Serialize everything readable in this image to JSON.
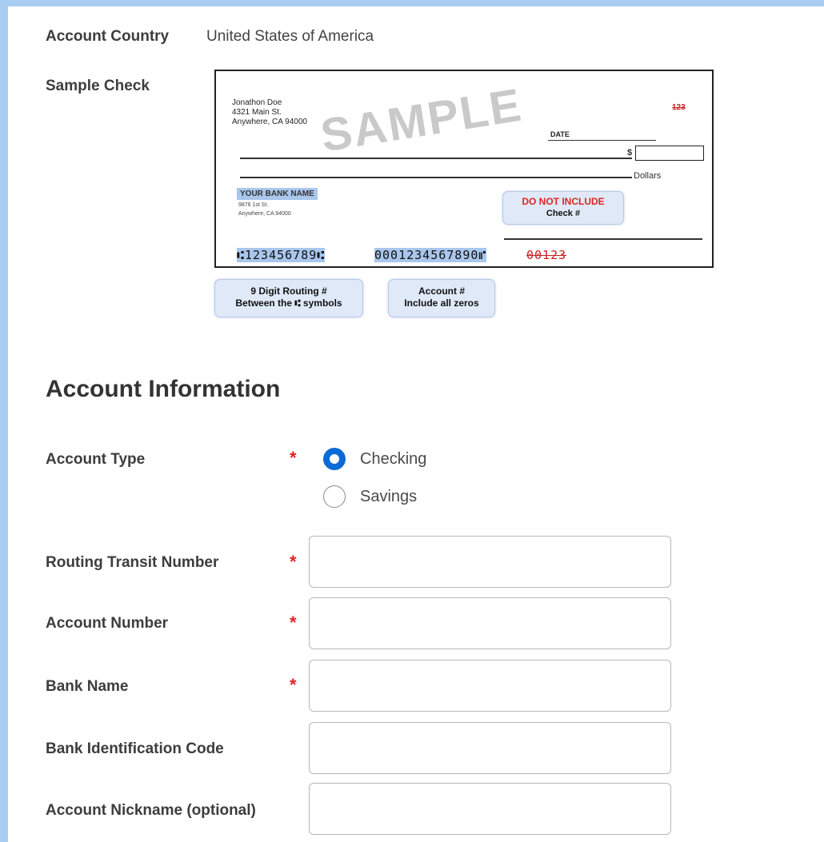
{
  "account_country": {
    "label": "Account Country",
    "value": "United States of America"
  },
  "sample_check": {
    "label": "Sample Check",
    "check": {
      "owner_name": "Jonathon Doe",
      "owner_street": "4321 Main St.",
      "owner_city": "Anywhere, CA 94000",
      "watermark": "SAMPLE",
      "check_number": "123",
      "date_label": "DATE",
      "dollar_sign": "$",
      "dollars_label": "Dollars",
      "bank_name": "YOUR BANK NAME",
      "bank_street": "9876 1st St.",
      "bank_city": "Anywhere, CA 94000",
      "routing_micr": "⑆123456789⑆",
      "account_micr": "0001234567890⑈",
      "check_micr": "00123",
      "do_not_include_1": "DO NOT INCLUDE",
      "do_not_include_2": "Check #"
    },
    "callouts": {
      "routing_line1": "9 Digit  Routing #",
      "routing_line2": "Between the ⑆ symbols",
      "account_line1": "Account #",
      "account_line2": "Include all zeros"
    }
  },
  "section_title": "Account Information",
  "account_type": {
    "label": "Account Type",
    "required_mark": "*",
    "options": [
      {
        "label": "Checking",
        "selected": true
      },
      {
        "label": "Savings",
        "selected": false
      }
    ]
  },
  "fields": [
    {
      "label": "Routing Transit Number",
      "required": true,
      "required_mark": "*",
      "value": ""
    },
    {
      "label": "Account Number",
      "required": true,
      "required_mark": "*",
      "value": ""
    },
    {
      "label": "Bank Name",
      "required": true,
      "required_mark": "*",
      "value": ""
    },
    {
      "label": "Bank Identification Code",
      "required": false,
      "value": ""
    },
    {
      "label": "Account Nickname (optional)",
      "required": false,
      "value": ""
    }
  ],
  "colors": {
    "accent": "#0b6bd6",
    "required": "#e02424",
    "frame": "#a9cdf0"
  }
}
